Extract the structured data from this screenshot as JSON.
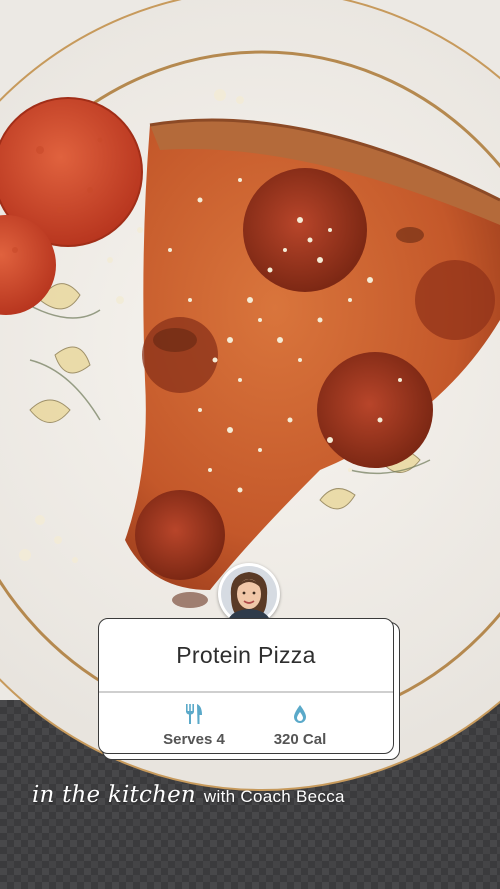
{
  "colors": {
    "accent": "#5aa9c9",
    "card_border": "#3a3a3a",
    "text_dark": "#2e2e2e",
    "plate_rim": "#b5894f"
  },
  "photo": {
    "subject": "pizza-slice-on-plate"
  },
  "card": {
    "title": "Protein Pizza",
    "stats": [
      {
        "icon": "fork-knife-icon",
        "label": "Serves 4"
      },
      {
        "icon": "water-drop-icon",
        "label": "320 Cal"
      }
    ]
  },
  "brand": {
    "script": "in the kitchen",
    "tagline": "with Coach Becca"
  }
}
